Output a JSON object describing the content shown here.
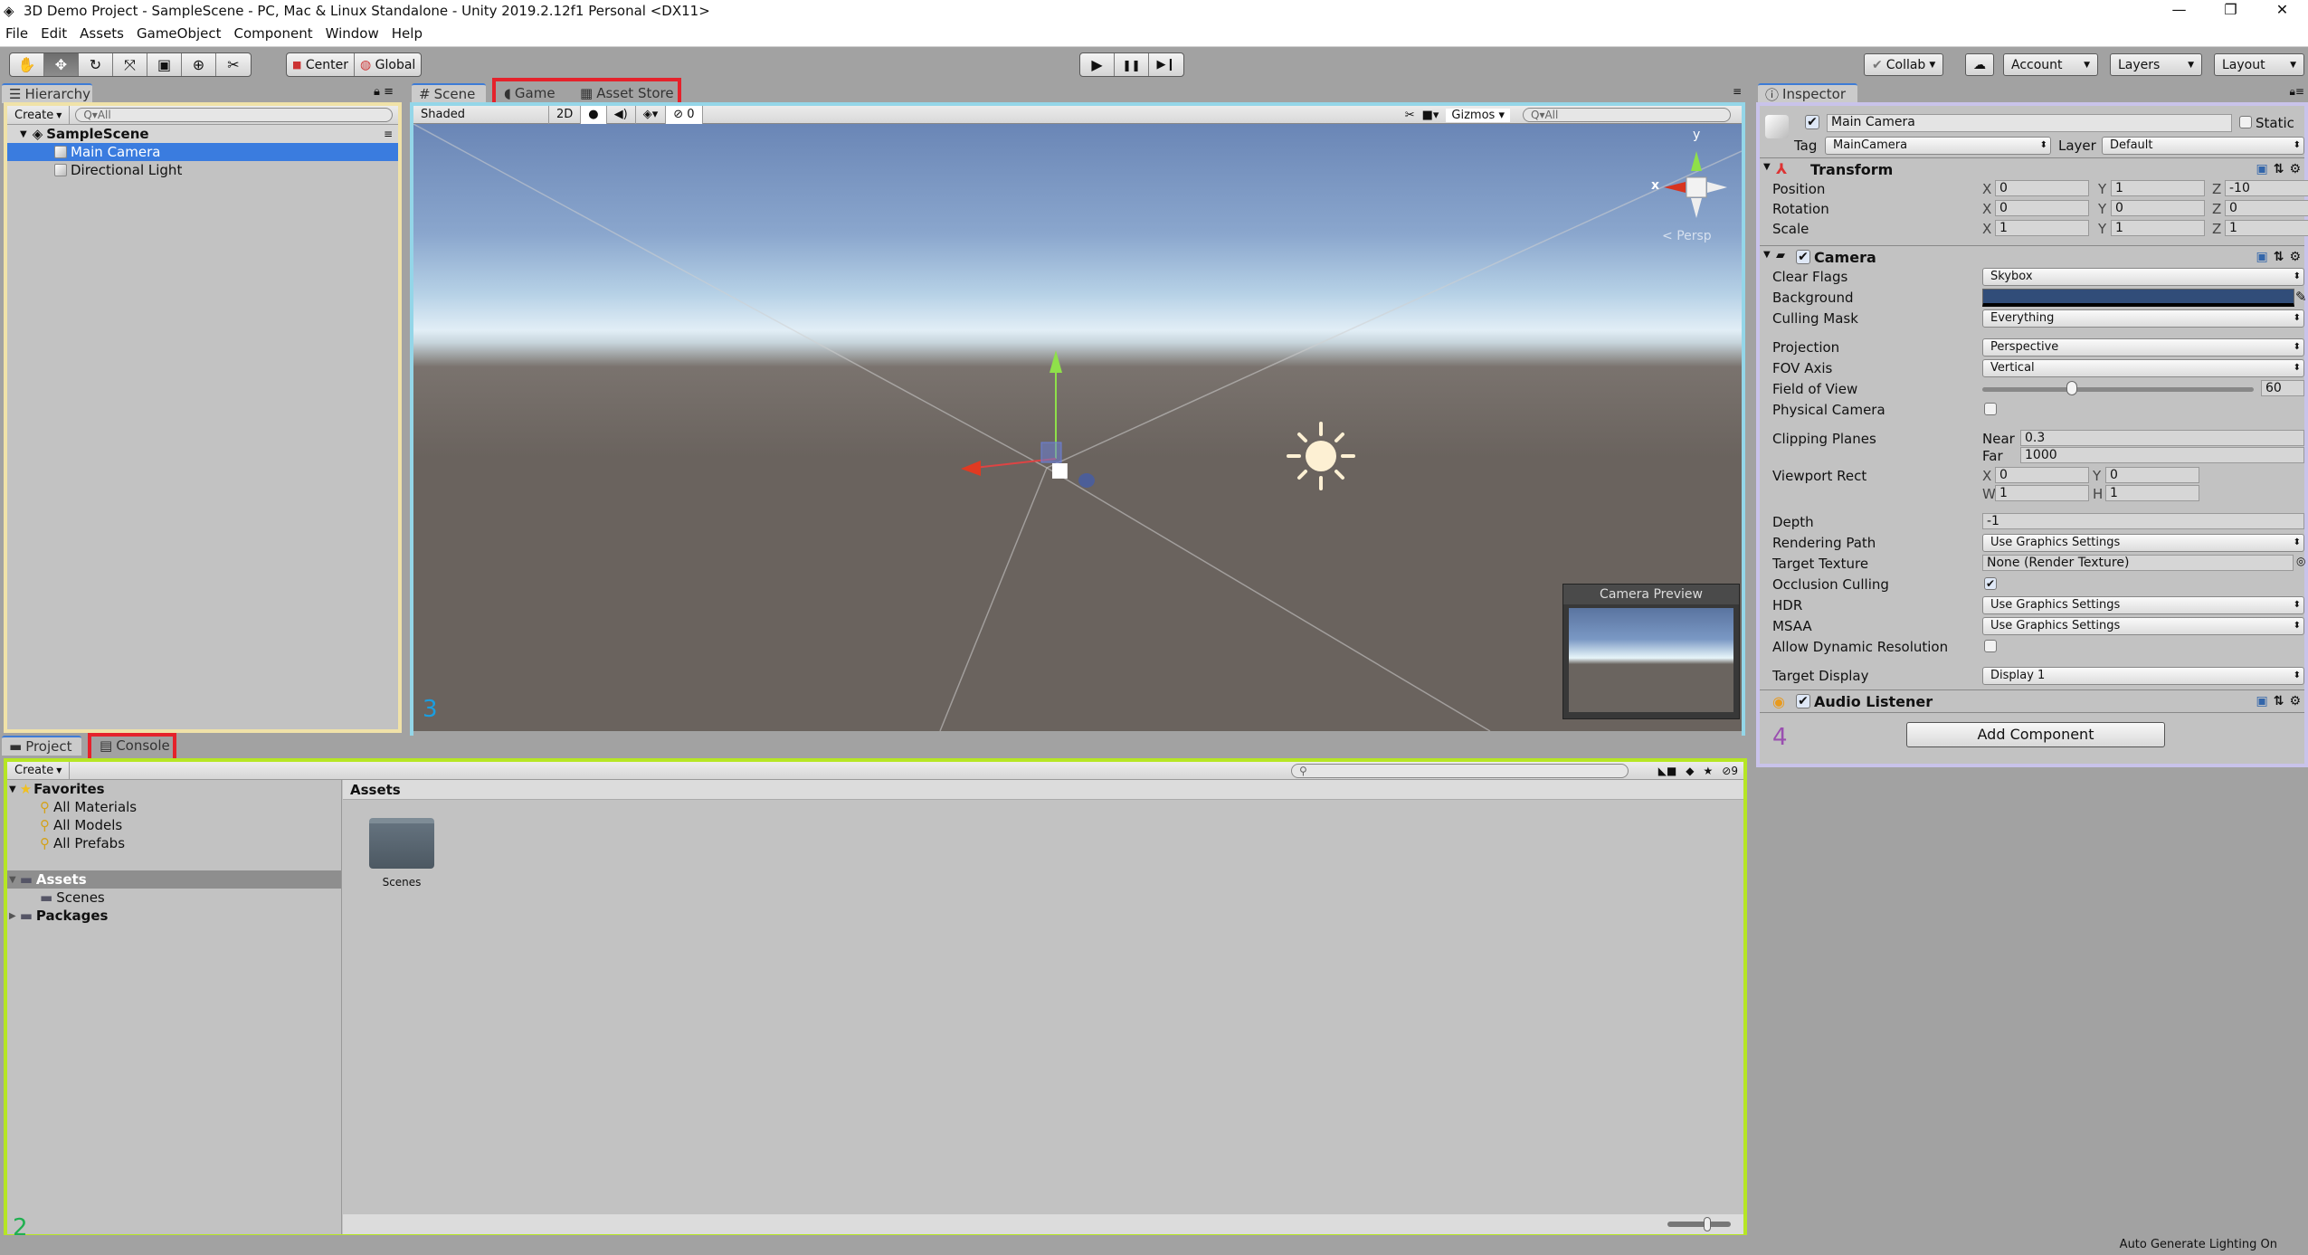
{
  "window": {
    "title": "3D Demo Project - SampleScene - PC, Mac & Linux Standalone - Unity 2019.2.12f1 Personal <DX11>",
    "controls": {
      "minimize": "—",
      "restore": "❐",
      "close": "✕"
    }
  },
  "menu": [
    "File",
    "Edit",
    "Assets",
    "GameObject",
    "Component",
    "Window",
    "Help"
  ],
  "toolbar": {
    "tools": [
      {
        "name": "hand-tool",
        "glyph": "✋"
      },
      {
        "name": "move-tool",
        "glyph": "✥"
      },
      {
        "name": "rotate-tool",
        "glyph": "↻"
      },
      {
        "name": "scale-tool",
        "glyph": "⤧"
      },
      {
        "name": "rect-tool",
        "glyph": "▣"
      },
      {
        "name": "transform-tool",
        "glyph": "⊕"
      },
      {
        "name": "custom-tool",
        "glyph": "✂"
      }
    ],
    "pivot": "Center",
    "space": "Global",
    "play": "▶",
    "pause": "❚❚",
    "step": "▶❙",
    "collab": "Collab",
    "cloud": "☁",
    "account": "Account",
    "layers": "Layers",
    "layout": "Layout"
  },
  "hierarchy": {
    "tab": "Hierarchy",
    "create": "Create",
    "search_placeholder": "Q▾All",
    "scene": "SampleScene",
    "items": [
      {
        "label": "Main Camera",
        "selected": true
      },
      {
        "label": "Directional Light",
        "selected": false
      }
    ]
  },
  "scene_view": {
    "tabs": [
      "Scene",
      "Game",
      "Asset Store"
    ],
    "shading": "Shaded",
    "mode_2d": "2D",
    "hidden_count": "0",
    "gizmos": "Gizmos",
    "search_placeholder": "Q▾All",
    "persp_label": "Persp",
    "axis_x_label": "x",
    "axis_y_label": "y",
    "camera_preview_title": "Camera Preview",
    "annotation": "3"
  },
  "inspector": {
    "tab": "Inspector",
    "object_name": "Main Camera",
    "active": true,
    "static_label": "Static",
    "tag_label": "Tag",
    "tag": "MainCamera",
    "layer_label": "Layer",
    "layer": "Default",
    "transform": {
      "title": "Transform",
      "rows": [
        {
          "label": "Position",
          "x": "0",
          "y": "1",
          "z": "-10"
        },
        {
          "label": "Rotation",
          "x": "0",
          "y": "0",
          "z": "0"
        },
        {
          "label": "Scale",
          "x": "1",
          "y": "1",
          "z": "1"
        }
      ]
    },
    "camera": {
      "title": "Camera",
      "enabled": true,
      "clear_flags_label": "Clear Flags",
      "clear_flags": "Skybox",
      "background_label": "Background",
      "background_color": "#314d79",
      "culling_mask_label": "Culling Mask",
      "culling_mask": "Everything",
      "projection_label": "Projection",
      "projection": "Perspective",
      "fov_axis_label": "FOV Axis",
      "fov_axis": "Vertical",
      "fov_label": "Field of View",
      "fov": "60",
      "fov_fraction": 0.33,
      "physical_label": "Physical Camera",
      "physical": false,
      "clipping_label": "Clipping Planes",
      "near_label": "Near",
      "near": "0.3",
      "far_label": "Far",
      "far": "1000",
      "viewport_label": "Viewport Rect",
      "vx": "0",
      "vy": "0",
      "vw": "1",
      "vh": "1",
      "depth_label": "Depth",
      "depth": "-1",
      "rendering_path_label": "Rendering Path",
      "rendering_path": "Use Graphics Settings",
      "target_texture_label": "Target Texture",
      "target_texture": "None (Render Texture)",
      "occlusion_label": "Occlusion Culling",
      "occlusion": true,
      "hdr_label": "HDR",
      "hdr": "Use Graphics Settings",
      "msaa_label": "MSAA",
      "msaa": "Use Graphics Settings",
      "dynres_label": "Allow Dynamic Resolution",
      "dynres": false,
      "target_display_label": "Target Display",
      "target_display": "Display 1"
    },
    "audio_listener": {
      "title": "Audio Listener",
      "enabled": true
    },
    "add_component": "Add Component",
    "annotation": "4"
  },
  "project": {
    "tabs": [
      "Project",
      "Console"
    ],
    "create": "Create",
    "hidden_count": "9",
    "favorites_label": "Favorites",
    "favorites": [
      "All Materials",
      "All Models",
      "All Prefabs"
    ],
    "assets_label": "Assets",
    "asset_children": [
      "Scenes"
    ],
    "packages_label": "Packages",
    "breadcrumb": "Assets",
    "grid_items": [
      {
        "label": "Scenes",
        "type": "folder"
      }
    ],
    "annotation": "2"
  },
  "status": {
    "text": "Auto Generate Lighting On"
  }
}
